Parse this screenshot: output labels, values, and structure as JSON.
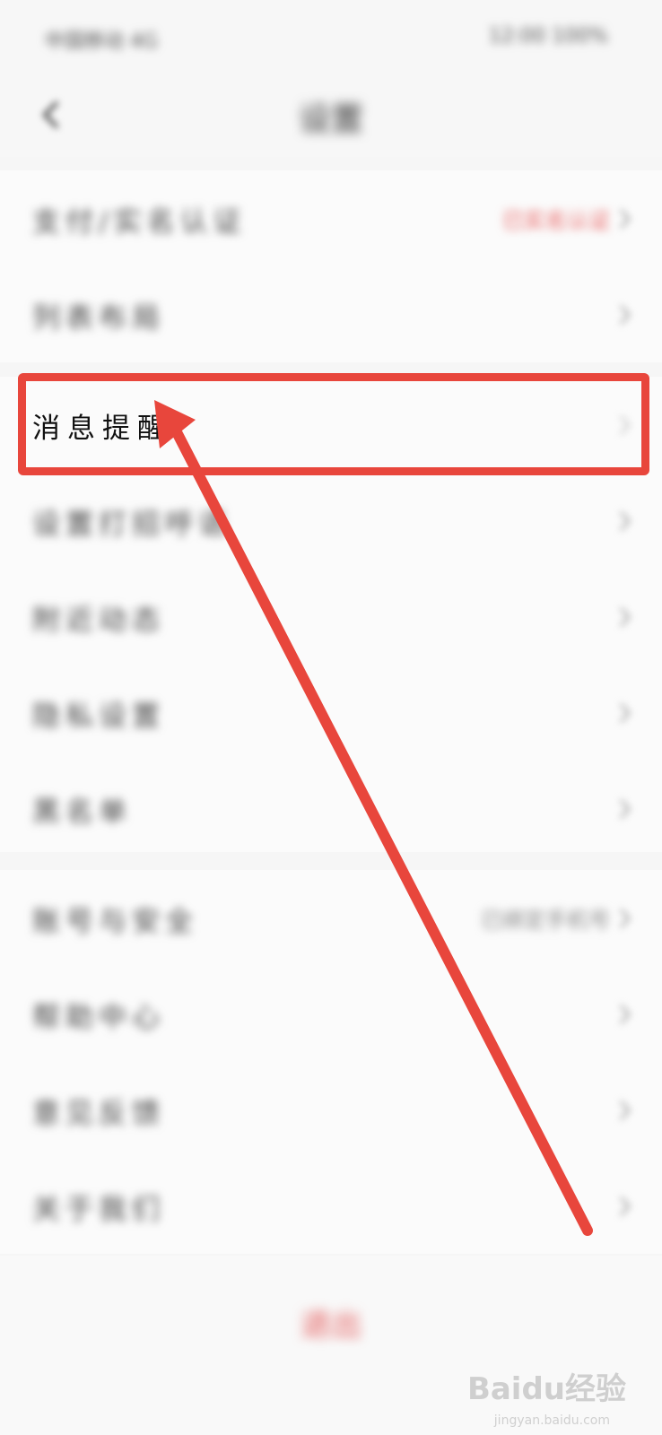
{
  "status_bar": {
    "left_text": "中国移动 4G",
    "right_text": "12:00 100%"
  },
  "nav": {
    "title": "设置"
  },
  "group1": [
    {
      "label": "支付/实名认证",
      "value": "已实名认证",
      "value_color": "#e86060"
    },
    {
      "label": "列表布局",
      "value": ""
    }
  ],
  "group2": [
    {
      "label": "消息提醒",
      "value": ""
    },
    {
      "label": "设置打招呼语",
      "value": ""
    },
    {
      "label": "附近动态",
      "value": ""
    },
    {
      "label": "隐私设置",
      "value": ""
    },
    {
      "label": "黑名单",
      "value": ""
    }
  ],
  "group3": [
    {
      "label": "账号与安全",
      "value": "已绑定手机号"
    },
    {
      "label": "帮助中心",
      "value": ""
    },
    {
      "label": "意见反馈",
      "value": ""
    },
    {
      "label": "关于我们",
      "value": ""
    }
  ],
  "logout": {
    "label": "退出"
  },
  "watermark": {
    "main": "Baidu经验",
    "sub": "jingyan.baidu.com"
  },
  "annotation": {
    "color": "#e8463c",
    "highlighted_item": "消息提醒"
  }
}
